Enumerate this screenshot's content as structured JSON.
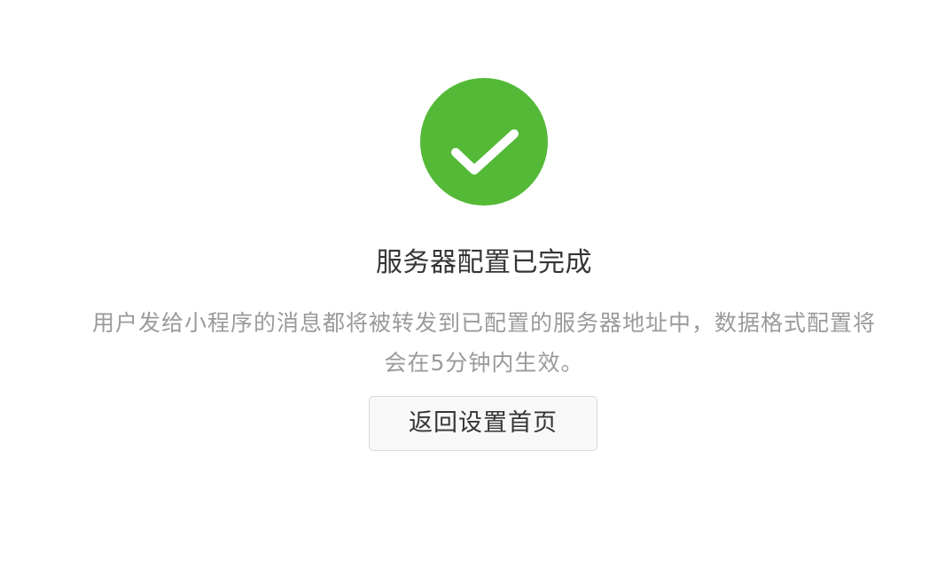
{
  "success": {
    "icon": "success-check-icon",
    "icon_color": "#54b937",
    "title": "服务器配置已完成",
    "description": "用户发给小程序的消息都将被转发到已配置的服务器地址中，数据格式配置将会在5分钟内生效。"
  },
  "actions": {
    "return_label": "返回设置首页"
  }
}
